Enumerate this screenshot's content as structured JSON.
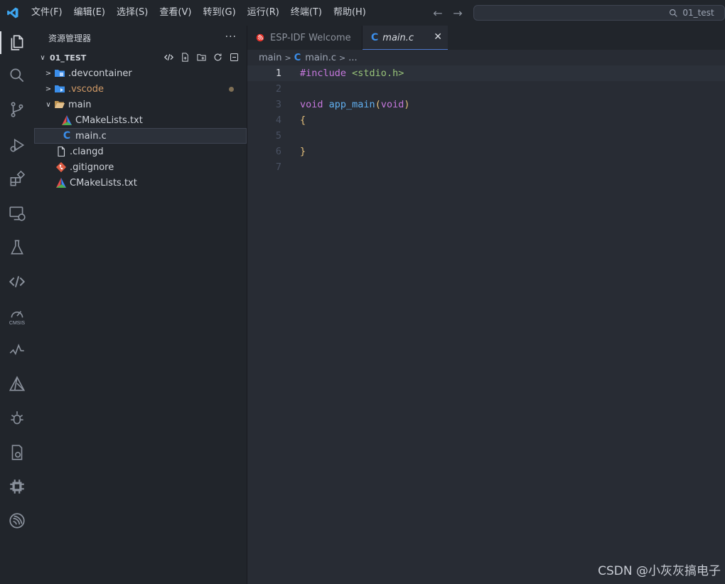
{
  "menu": [
    "文件(F)",
    "编辑(E)",
    "选择(S)",
    "查看(V)",
    "转到(G)",
    "运行(R)",
    "终端(T)",
    "帮助(H)"
  ],
  "search": {
    "text": "01_test"
  },
  "sidebar": {
    "title": "资源管理器",
    "more": "···",
    "folder": "01_TEST",
    "items": [
      {
        "label": ".devcontainer",
        "type": "folder",
        "state": "collapsed"
      },
      {
        "label": ".vscode",
        "type": "folder",
        "state": "collapsed",
        "modified": true
      },
      {
        "label": "main",
        "type": "folder",
        "state": "expanded"
      },
      {
        "label": "CMakeLists.txt",
        "type": "cmake"
      },
      {
        "label": "main.c",
        "type": "c",
        "selected": true
      },
      {
        "label": ".clangd",
        "type": "file"
      },
      {
        "label": ".gitignore",
        "type": "git"
      },
      {
        "label": "CMakeLists.txt",
        "type": "cmake"
      }
    ]
  },
  "tabs": [
    {
      "label": "ESP-IDF Welcome",
      "active": false
    },
    {
      "label": "main.c",
      "active": true
    }
  ],
  "breadcrumb": {
    "folder": "main",
    "file": "main.c",
    "more": "..."
  },
  "editor": {
    "line_numbers": [
      "1",
      "2",
      "3",
      "4",
      "5",
      "6",
      "7"
    ],
    "lines": {
      "l1_directive": "#include",
      "l1_header": "<stdio.h>",
      "l3_type": "void",
      "l3_func": "app_main",
      "l3_open": "(",
      "l3_arg": "void",
      "l3_close": ")",
      "l4": "{",
      "l6": "}"
    }
  },
  "watermark": "CSDN @小灰灰搞电子",
  "colors": {
    "accent": "#4d78cc",
    "keyword": "#c678dd",
    "function": "#61afef",
    "string": "#98c379",
    "bracket": "#e5c07b"
  }
}
